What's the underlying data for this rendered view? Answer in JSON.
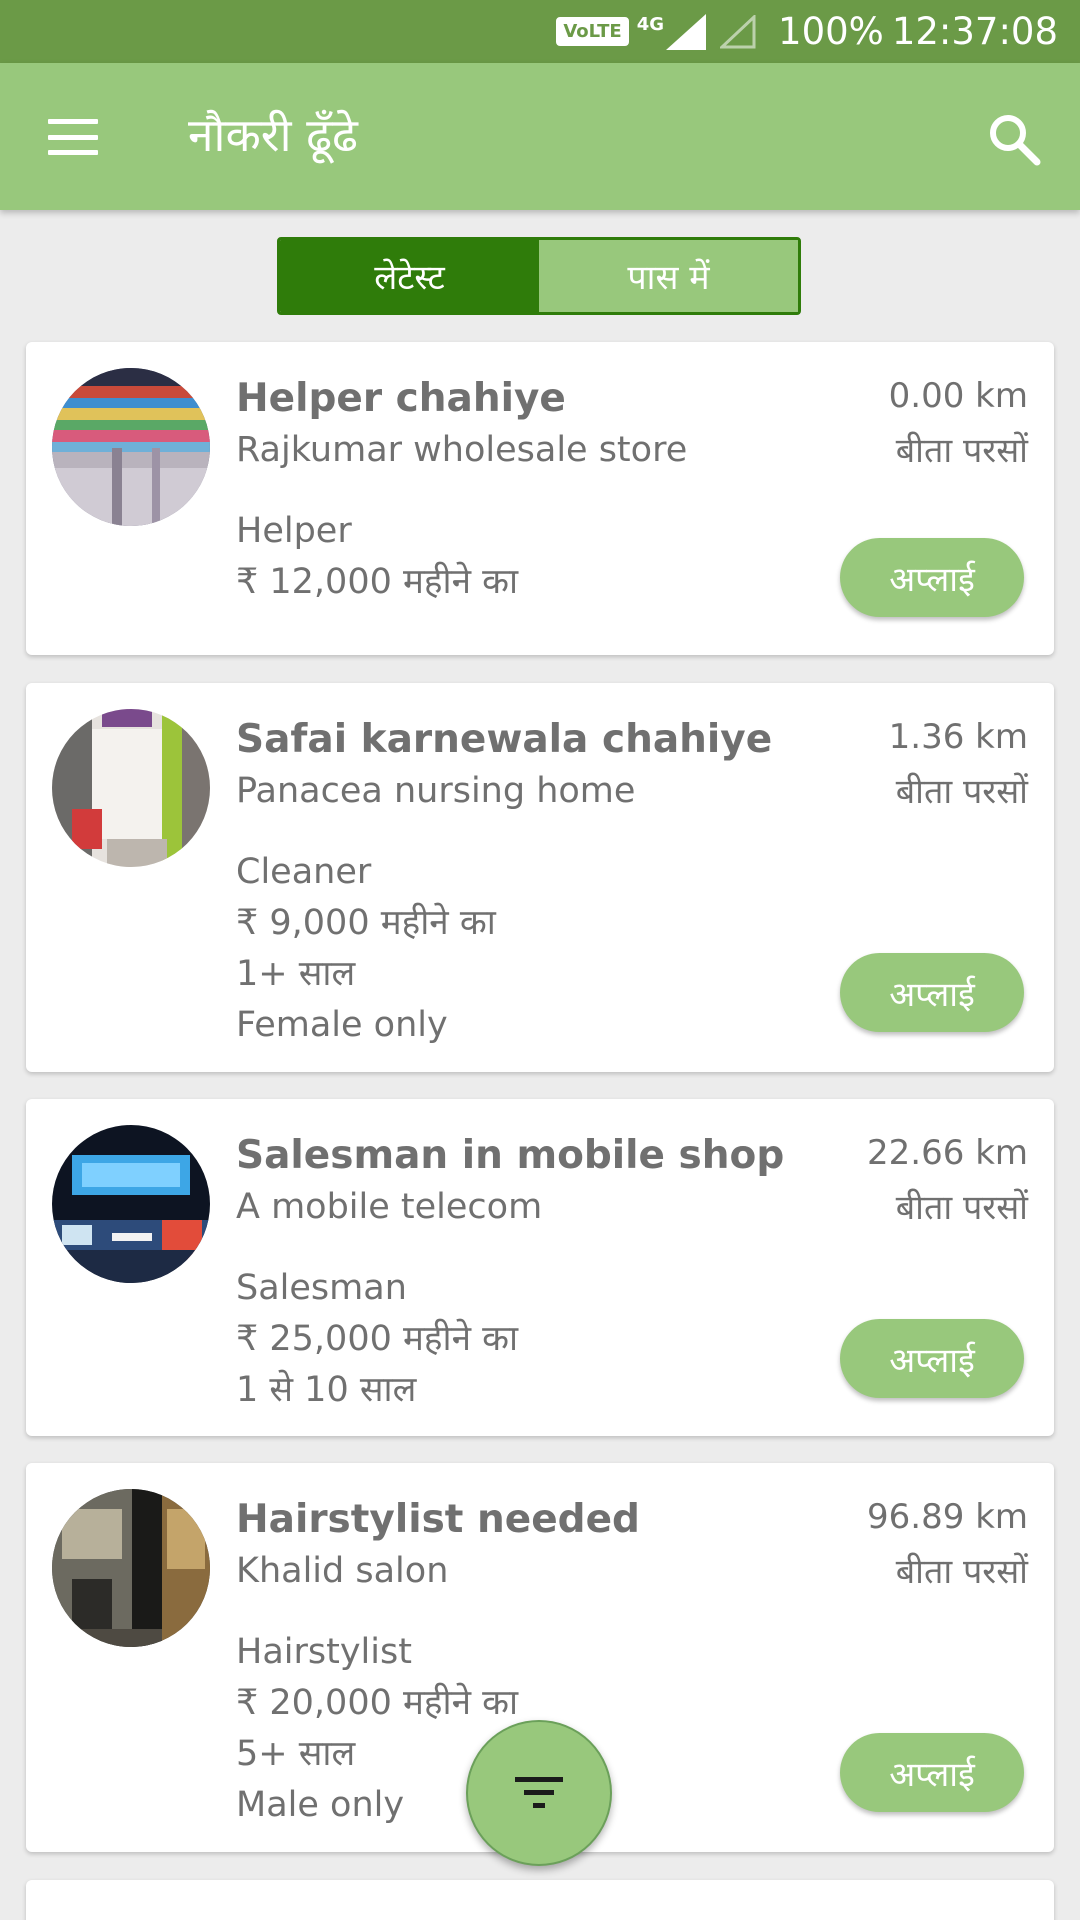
{
  "status_bar": {
    "volte": "VoLTE",
    "network": "4G",
    "battery": "100%",
    "time": "12:37:08"
  },
  "app_bar": {
    "title": "नौकरी ढूँढे",
    "menu_icon": "hamburger-menu-icon",
    "search_icon": "search-icon"
  },
  "tabs": [
    {
      "label": "लेटेस्ट",
      "active": true
    },
    {
      "label": "पास में",
      "active": false
    }
  ],
  "jobs": [
    {
      "title": "Helper chahiye",
      "company": "Rajkumar wholesale store",
      "details": [
        "Helper",
        "₹ 12,000 महीने का"
      ],
      "distance": "0.00 km",
      "posted": "बीता परसों",
      "apply_label": "अप्लाई"
    },
    {
      "title": "Safai karnewala chahiye",
      "company": "Panacea nursing home",
      "details": [
        "Cleaner",
        "₹ 9,000 महीने का",
        "1+ साल",
        "Female only"
      ],
      "distance": "1.36 km",
      "posted": "बीता परसों",
      "apply_label": "अप्लाई"
    },
    {
      "title": "Salesman in mobile shop",
      "company": "A mobile telecom",
      "details": [
        "Salesman",
        "₹ 25,000 महीने का",
        "1 से 10 साल"
      ],
      "distance": "22.66 km",
      "posted": "बीता परसों",
      "apply_label": "अप्लाई"
    },
    {
      "title": "Hairstylist needed",
      "company": "Khalid salon",
      "details": [
        "Hairstylist",
        "₹ 20,000 महीने का",
        "5+ साल",
        "Male only"
      ],
      "distance": "96.89 km",
      "posted": "बीता परसों",
      "apply_label": "अप्लाई"
    }
  ],
  "fab": {
    "icon": "filter-icon"
  },
  "colors": {
    "status_bar": "#6b9a47",
    "app_bar": "#98c87c",
    "tab_active": "#2f7c0a",
    "apply_button": "#98c87c"
  }
}
